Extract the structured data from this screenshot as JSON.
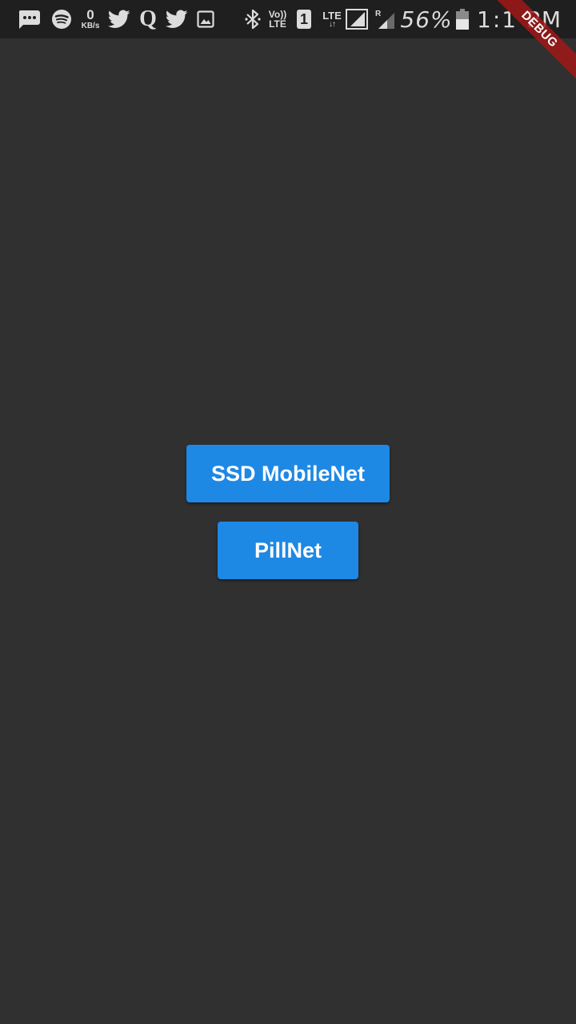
{
  "status_bar": {
    "net_speed_value": "0",
    "net_speed_unit": "KB/s",
    "quora_letter": "Q",
    "volte_top": "Vo))",
    "volte_bottom": "LTE",
    "sim_slot": "1",
    "lte_label": "LTE",
    "lte_arrows": "↓↑",
    "roaming_label": "R",
    "battery_percent": "56%",
    "battery_level": 0.56,
    "time": "1:1 PM",
    "icons": [
      "messages-icon",
      "spotify-icon",
      "twitter-icon",
      "quora-icon",
      "twitter-icon",
      "image-icon",
      "bluetooth-icon",
      "volte-icon",
      "sim-icon",
      "lte-signal-icon",
      "roaming-signal-icon",
      "battery-icon"
    ]
  },
  "debug_banner": {
    "label": "DEBUG"
  },
  "main": {
    "buttons": [
      {
        "label": "SSD MobileNet"
      },
      {
        "label": "PillNet"
      }
    ]
  },
  "colors": {
    "background": "#303030",
    "status_bar": "#1f1f1f",
    "button": "#1e88e5",
    "button_text": "#ffffff",
    "debug_ribbon": "#a01818"
  }
}
